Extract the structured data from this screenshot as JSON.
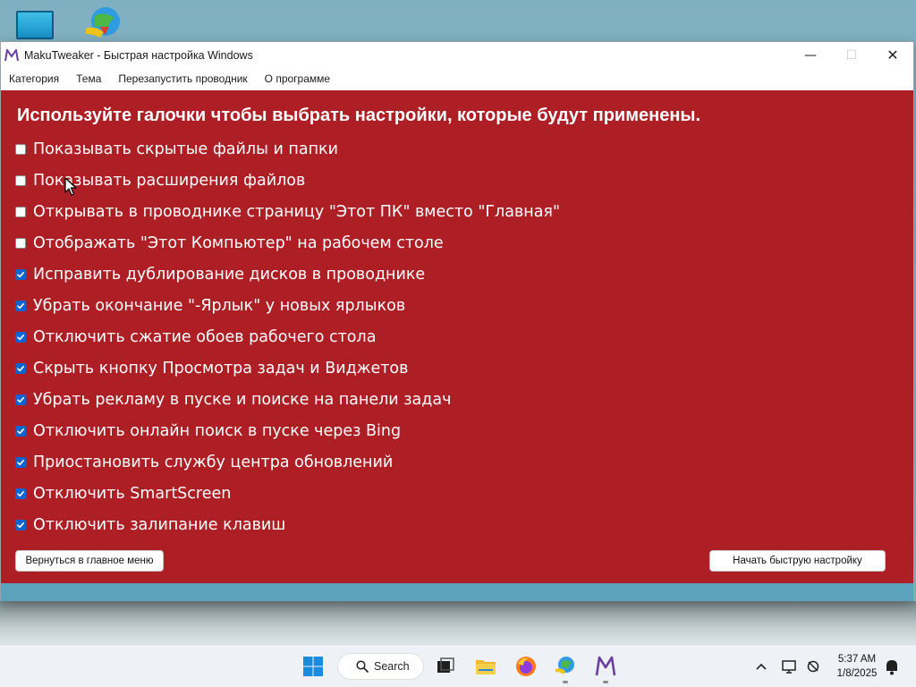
{
  "desktop": {
    "icons": [
      "monitor-icon",
      "idm-icon"
    ]
  },
  "window": {
    "title": "MakuTweaker - Быстрая настройка Windows",
    "controls": {
      "minimize": "—",
      "maximize": "☐",
      "close": "✕"
    },
    "menu": [
      {
        "label": "Категория"
      },
      {
        "label": "Тема"
      },
      {
        "label": "Перезапустить проводник"
      },
      {
        "label": "О программе"
      }
    ],
    "accent_color": "#ad1f24"
  },
  "content": {
    "heading": "Используйте галочки чтобы выбрать настройки, которые будут применены.",
    "options": [
      {
        "label": "Показывать скрытые файлы и папки",
        "checked": false
      },
      {
        "label": "Показывать расширения файлов",
        "checked": false
      },
      {
        "label": "Открывать в проводнике страницу \"Этот ПК\" вместо \"Главная\"",
        "checked": false
      },
      {
        "label": "Отображать \"Этот Компьютер\" на рабочем столе",
        "checked": false
      },
      {
        "label": "Исправить дублирование дисков в проводнике",
        "checked": true
      },
      {
        "label": "Убрать окончание \"-Ярлык\" у новых ярлыков",
        "checked": true
      },
      {
        "label": "Отключить сжатие обоев рабочего стола",
        "checked": true
      },
      {
        "label": "Скрыть кнопку Просмотра задач и Виджетов",
        "checked": true
      },
      {
        "label": "Убрать рекламу в пуске и поиске на панели задач",
        "checked": true
      },
      {
        "label": "Отключить онлайн поиск в пуске через Bing",
        "checked": true
      },
      {
        "label": "Приостановить службу центра обновлений",
        "checked": true
      },
      {
        "label": "Отключить SmartScreen",
        "checked": true
      },
      {
        "label": "Отключить залипание клавиш",
        "checked": true
      }
    ],
    "back_button": "Вернуться в главное меню",
    "start_button": "Начать быструю настройку"
  },
  "taskbar": {
    "search_label": "Search",
    "time": "5:37 AM",
    "date": "1/8/2025",
    "icons": [
      "windows-start-icon",
      "search-icon",
      "task-view-icon",
      "file-explorer-icon",
      "firefox-icon",
      "idm-icon",
      "makutweaker-icon",
      "chevron-up-icon",
      "network-icon",
      "accessibility-icon",
      "notification-bell-icon"
    ]
  }
}
